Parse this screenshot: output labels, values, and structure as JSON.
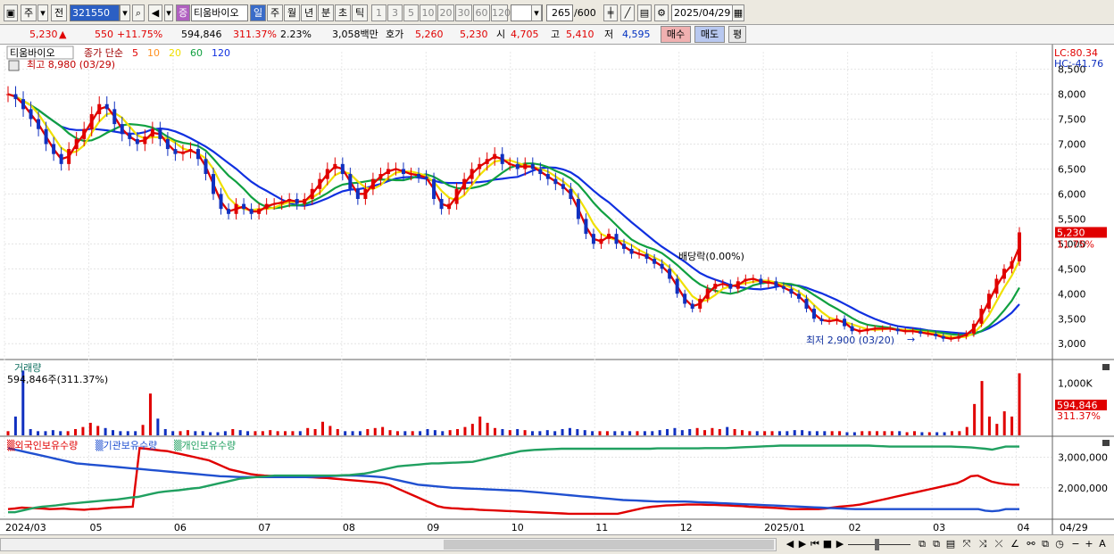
{
  "toolbar": {
    "type_label": "주",
    "prev_label": "전",
    "code": "321550",
    "sound_label": "◀",
    "badge_label": "증",
    "name": "티움바이오",
    "periods": [
      "일",
      "주",
      "월",
      "년",
      "분",
      "초",
      "틱"
    ],
    "active_period": "일",
    "intervals": [
      "1",
      "3",
      "5",
      "10",
      "20",
      "30",
      "60",
      "120"
    ],
    "count": "265",
    "count_total": "/600",
    "date": "2025/04/29"
  },
  "quote": {
    "price": "5,230",
    "arrow": "▲",
    "change": "550",
    "change_pct": "+11.75%",
    "volume": "594,846",
    "volume_ratio": "311.37%",
    "turnover": "2.23%",
    "amount": "3,058백만",
    "ask_label": "호가",
    "ask": "5,260",
    "bid": "5,230",
    "open_label": "시",
    "open": "4,705",
    "high_label": "고",
    "high": "5,410",
    "low_label": "저",
    "low": "4,595",
    "buy_label": "매수",
    "sell_label": "매도",
    "eval_label": "평"
  },
  "chart_data": [
    {
      "type": "line",
      "title": "티움바이오",
      "ma_label": "종가 단순",
      "ma_periods": [
        "5",
        "10",
        "20",
        "60",
        "120"
      ],
      "ma_colors": [
        "#e00000",
        "#ff9020",
        "#f0e000",
        "#10a040",
        "#1030e0"
      ],
      "high_annotation": "최고 8,980 (03/29)",
      "low_annotation": "최저 2,900 (03/20)",
      "dividend_annotation": "배당락(0.00%)",
      "lc_label": "LC:80.34",
      "hc_label": "HC:-41.76",
      "current_price_label": "5,230",
      "current_pct_label": "11.75%",
      "y_ticks": [
        "8,500",
        "8,000",
        "7,500",
        "7,000",
        "6,500",
        "6,000",
        "5,500",
        "5,000",
        "4,500",
        "4,000",
        "3,500",
        "3,000"
      ],
      "ylim": [
        2700,
        8850
      ],
      "x_labels": [
        "2024/03",
        "05",
        "06",
        "07",
        "08",
        "09",
        "10",
        "11",
        "12",
        "2025/01",
        "02",
        "03",
        "04",
        "04/29"
      ],
      "close_series": [
        8000,
        7900,
        7700,
        7500,
        7300,
        7000,
        6800,
        6600,
        6900,
        7100,
        7300,
        7600,
        7800,
        7700,
        7400,
        7200,
        7100,
        7000,
        7150,
        7300,
        7100,
        6900,
        6800,
        6850,
        6900,
        6700,
        6400,
        6000,
        5700,
        5600,
        5800,
        5700,
        5600,
        5700,
        5800,
        5800,
        5850,
        5900,
        5800,
        5900,
        6100,
        6300,
        6500,
        6600,
        6400,
        6100,
        5900,
        6100,
        6300,
        6400,
        6500,
        6500,
        6400,
        6400,
        6350,
        6300,
        5900,
        5700,
        5800,
        6100,
        6300,
        6500,
        6600,
        6700,
        6800,
        6600,
        6600,
        6500,
        6600,
        6500,
        6400,
        6300,
        6200,
        6100,
        5900,
        5500,
        5200,
        5000,
        5100,
        5200,
        5000,
        4900,
        4800,
        4800,
        4700,
        4600,
        4500,
        4300,
        4000,
        3800,
        3700,
        3900,
        4100,
        4200,
        4200,
        4100,
        4250,
        4300,
        4300,
        4200,
        4250,
        4150,
        4100,
        4000,
        3900,
        3700,
        3500,
        3450,
        3450,
        3500,
        3350,
        3250,
        3250,
        3300,
        3300,
        3300,
        3300,
        3250,
        3250,
        3250,
        3200,
        3200,
        3150,
        3100,
        3100,
        3150,
        3200,
        3400,
        3700,
        4000,
        4300,
        4500,
        4650,
        5230
      ],
      "volume": {
        "label": "거래량",
        "value_label": "594,846주(311.37%)",
        "axis_tick": "1,000K",
        "current_label": "594,846",
        "current_pct": "311.37%",
        "values": [
          40,
          180,
          620,
          60,
          40,
          40,
          50,
          40,
          40,
          60,
          80,
          120,
          90,
          70,
          50,
          40,
          40,
          40,
          100,
          400,
          160,
          60,
          40,
          40,
          50,
          40,
          40,
          30,
          30,
          40,
          60,
          50,
          40,
          40,
          40,
          50,
          40,
          40,
          40,
          40,
          70,
          60,
          130,
          90,
          60,
          40,
          40,
          40,
          60,
          70,
          80,
          50,
          40,
          40,
          40,
          40,
          60,
          50,
          40,
          50,
          60,
          80,
          110,
          180,
          120,
          70,
          60,
          50,
          60,
          50,
          40,
          40,
          50,
          40,
          60,
          70,
          60,
          50,
          40,
          40,
          40,
          40,
          40,
          40,
          40,
          40,
          40,
          50,
          60,
          70,
          50,
          60,
          70,
          50,
          70,
          60,
          80,
          60,
          50,
          40,
          40,
          40,
          40,
          40,
          40,
          50,
          50,
          40,
          40,
          40,
          40,
          40,
          30,
          30,
          40,
          40,
          40,
          40,
          40,
          40,
          30,
          40,
          30,
          30,
          30,
          30,
          40,
          40,
          80,
          300,
          520,
          180,
          110,
          230,
          180,
          594
        ]
      },
      "holdings": {
        "legend": [
          "외국인보유수량",
          "기관보유수량",
          "개인보유수량"
        ],
        "colors": [
          "#e00000",
          "#2050d0",
          "#20a060"
        ],
        "y_ticks": [
          "3,000,000",
          "2,000,000"
        ],
        "ylim": [
          1000000,
          3600000
        ],
        "foreign": [
          1300000,
          1320000,
          1350000,
          1340000,
          1330000,
          1320000,
          1300000,
          1310000,
          1320000,
          1300000,
          1290000,
          1280000,
          1300000,
          1310000,
          1330000,
          1350000,
          1360000,
          1370000,
          1380000,
          3300000,
          3280000,
          3250000,
          3220000,
          3200000,
          3150000,
          3100000,
          3050000,
          3000000,
          2950000,
          2900000,
          2800000,
          2700000,
          2600000,
          2550000,
          2500000,
          2450000,
          2420000,
          2400000,
          2390000,
          2380000,
          2380000,
          2370000,
          2360000,
          2350000,
          2340000,
          2330000,
          2320000,
          2300000,
          2280000,
          2260000,
          2240000,
          2220000,
          2200000,
          2180000,
          2150000,
          2100000,
          2000000,
          1900000,
          1800000,
          1700000,
          1600000,
          1500000,
          1400000,
          1350000,
          1330000,
          1320000,
          1300000,
          1300000,
          1280000,
          1270000,
          1260000,
          1250000,
          1240000,
          1230000,
          1220000,
          1210000,
          1200000,
          1190000,
          1180000,
          1170000,
          1160000,
          1150000,
          1150000,
          1150000,
          1150000,
          1150000,
          1150000,
          1150000,
          1150000,
          1200000,
          1250000,
          1300000,
          1350000,
          1380000,
          1400000,
          1420000,
          1430000,
          1440000,
          1450000,
          1450000,
          1450000,
          1440000,
          1440000,
          1430000,
          1420000,
          1410000,
          1400000,
          1380000,
          1370000,
          1360000,
          1350000,
          1340000,
          1320000,
          1300000,
          1300000,
          1300000,
          1300000,
          1300000,
          1320000,
          1350000,
          1380000,
          1400000,
          1420000,
          1450000,
          1500000,
          1550000,
          1600000,
          1650000,
          1700000,
          1750000,
          1800000,
          1850000,
          1900000,
          1950000,
          2000000,
          2050000,
          2100000,
          2150000,
          2250000,
          2380000,
          2400000,
          2300000,
          2200000,
          2150000,
          2120000,
          2100000,
          2100000
        ],
        "institution": [
          3300000,
          3250000,
          3200000,
          3150000,
          3100000,
          3050000,
          3000000,
          2950000,
          2900000,
          2850000,
          2800000,
          2780000,
          2760000,
          2740000,
          2720000,
          2700000,
          2680000,
          2660000,
          2640000,
          2620000,
          2600000,
          2580000,
          2560000,
          2540000,
          2520000,
          2500000,
          2480000,
          2460000,
          2440000,
          2420000,
          2400000,
          2380000,
          2370000,
          2360000,
          2350000,
          2350000,
          2350000,
          2350000,
          2350000,
          2350000,
          2350000,
          2350000,
          2350000,
          2350000,
          2350000,
          2360000,
          2370000,
          2380000,
          2390000,
          2400000,
          2400000,
          2400000,
          2390000,
          2380000,
          2360000,
          2340000,
          2300000,
          2250000,
          2200000,
          2150000,
          2100000,
          2080000,
          2060000,
          2040000,
          2020000,
          2000000,
          1990000,
          1980000,
          1970000,
          1960000,
          1950000,
          1940000,
          1930000,
          1920000,
          1910000,
          1900000,
          1880000,
          1860000,
          1840000,
          1820000,
          1800000,
          1780000,
          1760000,
          1740000,
          1720000,
          1700000,
          1680000,
          1660000,
          1640000,
          1620000,
          1600000,
          1590000,
          1580000,
          1570000,
          1560000,
          1550000,
          1550000,
          1550000,
          1550000,
          1550000,
          1540000,
          1530000,
          1520000,
          1510000,
          1500000,
          1490000,
          1480000,
          1470000,
          1460000,
          1450000,
          1440000,
          1430000,
          1420000,
          1410000,
          1400000,
          1390000,
          1380000,
          1370000,
          1360000,
          1350000,
          1340000,
          1330000,
          1320000,
          1310000,
          1300000,
          1300000,
          1300000,
          1300000,
          1300000,
          1300000,
          1300000,
          1300000,
          1300000,
          1300000,
          1300000,
          1300000,
          1300000,
          1300000,
          1300000,
          1300000,
          1300000,
          1300000,
          1300000,
          1250000,
          1230000,
          1250000,
          1300000,
          1300000,
          1300000
        ],
        "individual": [
          1200000,
          1200000,
          1250000,
          1300000,
          1350000,
          1380000,
          1400000,
          1420000,
          1450000,
          1480000,
          1500000,
          1520000,
          1540000,
          1560000,
          1580000,
          1600000,
          1620000,
          1650000,
          1680000,
          1700000,
          1750000,
          1800000,
          1850000,
          1880000,
          1900000,
          1920000,
          1950000,
          1980000,
          2000000,
          2050000,
          2100000,
          2150000,
          2200000,
          2250000,
          2300000,
          2320000,
          2340000,
          2360000,
          2380000,
          2400000,
          2400000,
          2400000,
          2400000,
          2400000,
          2400000,
          2400000,
          2400000,
          2400000,
          2400000,
          2410000,
          2420000,
          2440000,
          2460000,
          2500000,
          2550000,
          2600000,
          2650000,
          2700000,
          2720000,
          2740000,
          2760000,
          2780000,
          2800000,
          2800000,
          2810000,
          2820000,
          2830000,
          2840000,
          2850000,
          2900000,
          2950000,
          3000000,
          3050000,
          3100000,
          3150000,
          3200000,
          3220000,
          3240000,
          3250000,
          3260000,
          3270000,
          3280000,
          3280000,
          3280000,
          3280000,
          3280000,
          3280000,
          3280000,
          3280000,
          3280000,
          3280000,
          3280000,
          3280000,
          3280000,
          3280000,
          3290000,
          3290000,
          3290000,
          3290000,
          3290000,
          3290000,
          3290000,
          3300000,
          3300000,
          3300000,
          3300000,
          3310000,
          3320000,
          3330000,
          3340000,
          3350000,
          3360000,
          3370000,
          3380000,
          3380000,
          3380000,
          3380000,
          3380000,
          3380000,
          3380000,
          3380000,
          3380000,
          3380000,
          3380000,
          3380000,
          3380000,
          3380000,
          3370000,
          3360000,
          3350000,
          3350000,
          3350000,
          3350000,
          3350000,
          3350000,
          3350000,
          3350000,
          3350000,
          3350000,
          3340000,
          3330000,
          3320000,
          3300000,
          3280000,
          3250000,
          3300000,
          3350000,
          3350000,
          3350000
        ]
      }
    }
  ],
  "bottombar": {
    "nav": [
      "◀",
      "▶",
      "⏮",
      "■",
      "▶"
    ],
    "tools": [
      "−",
      "+",
      "A"
    ]
  }
}
